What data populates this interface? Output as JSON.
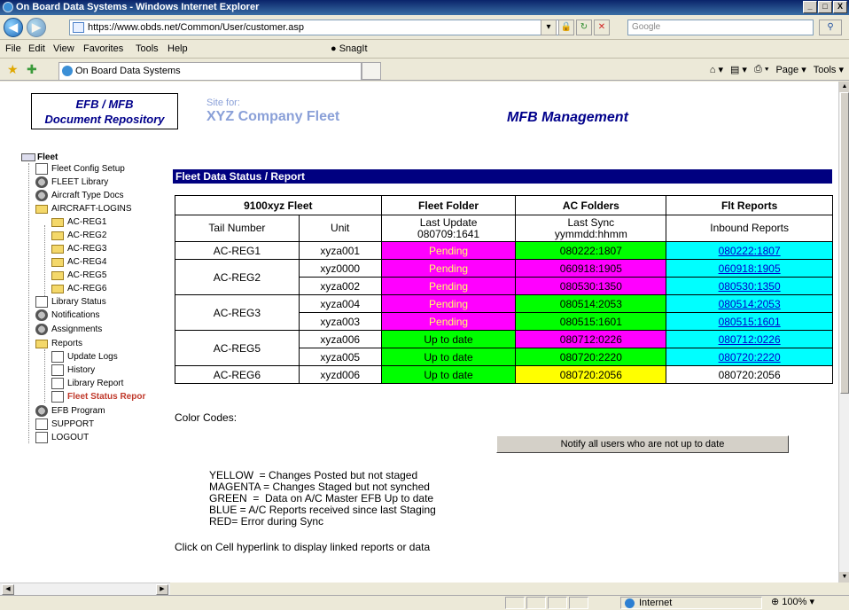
{
  "window": {
    "title": "On Board Data Systems - Windows Internet Explorer",
    "min": "_",
    "max": "□",
    "close": "X"
  },
  "address": {
    "url": "https://www.obds.net/Common/User/customer.asp",
    "search_placeholder": "Google"
  },
  "menu": {
    "items": [
      "File",
      "Edit",
      "View",
      "Favorites",
      "Tools",
      "Help"
    ],
    "snagit": "SnagIt"
  },
  "tab": {
    "title": "On Board Data Systems"
  },
  "commands": {
    "page": "Page",
    "tools": "Tools"
  },
  "header": {
    "logo_line1": "EFB / MFB",
    "logo_line2": "Document Repository",
    "site_for": "Site for:",
    "company": "XYZ Company  Fleet",
    "mfb": "MFB Management"
  },
  "tree": {
    "root": "Fleet",
    "items": [
      "Fleet Config Setup",
      "FLEET Library",
      "Aircraft Type Docs",
      "AIRCRAFT-LOGINS",
      "AC-REG1",
      "AC-REG2",
      "AC-REG3",
      "AC-REG4",
      "AC-REG5",
      "AC-REG6",
      "Library Status",
      "Notifications",
      "Assignments",
      "Reports",
      "Update Logs",
      "History",
      "Library Report",
      "Fleet Status Repor",
      "EFB Program",
      "SUPPORT",
      "LOGOUT"
    ]
  },
  "report": {
    "section_title": "Fleet Data Status / Report",
    "headers": {
      "fleet": "9100xyz Fleet",
      "folder": "Fleet Folder",
      "ac": "AC Folders",
      "flt": "Flt Reports"
    },
    "subheaders": {
      "tail": "Tail Number",
      "unit": "Unit",
      "folder_l1": "Last Update",
      "folder_l2": "080709:1641",
      "ac_l1": "Last Sync",
      "ac_l2": "yymmdd:hhmm",
      "flt": "Inbound Reports"
    },
    "rows": {
      "r1": {
        "tail": "AC-REG1",
        "unit": "xyza001",
        "folder": "Pending",
        "ac": "080222:1807",
        "flt": "080222:1807"
      },
      "r2": {
        "tail": "AC-REG2",
        "unit": "xyz0000",
        "folder": "Pending",
        "ac": "060918:1905",
        "flt": "060918:1905"
      },
      "r3": {
        "unit": "xyza002",
        "folder": "Pending",
        "ac": "080530:1350",
        "flt": "080530:1350"
      },
      "r4": {
        "tail": "AC-REG3",
        "unit": "xyza004",
        "folder": "Pending",
        "ac": "080514:2053",
        "flt": "080514:2053"
      },
      "r5": {
        "unit": "xyza003",
        "folder": "Pending",
        "ac": "080515:1601",
        "flt": "080515:1601"
      },
      "r6": {
        "tail": "AC-REG5",
        "unit": "xyza006",
        "folder": "Up to date",
        "ac": "080712:0226",
        "flt": "080712:0226"
      },
      "r7": {
        "unit": "xyza005",
        "folder": "Up to date",
        "ac": "080720:2220",
        "flt": "080720:2220"
      },
      "r8": {
        "tail": "AC-REG6",
        "unit": "xyzd006",
        "folder": "Up to date",
        "ac": "080720:2056",
        "flt": "080720:2056"
      }
    },
    "colors": {
      "magenta": "#ff00ff",
      "green": "#00ff00",
      "cyan": "#00ffff",
      "yellow": "#ffff00",
      "navy": "#000080"
    }
  },
  "footer": {
    "color_codes": "Color Codes:",
    "notify_button": "Notify all users who are not up to date",
    "legend": [
      "YELLOW  = Changes Posted but not staged",
      "MAGENTA = Changes Staged but not synched",
      "GREEN  =  Data on A/C Master EFB Up to date",
      "BLUE = A/C Reports received since last Staging",
      "RED= Error during Sync"
    ],
    "hint": "Click on Cell hyperlink to display linked reports or data"
  },
  "status": {
    "zone": "Internet",
    "zoom": "100%"
  },
  "icons": [
    "ie-icon",
    "back-icon",
    "forward-icon",
    "lock-icon",
    "refresh-icon",
    "stop-icon",
    "search-icon",
    "favorites-star-icon",
    "add-favorite-icon",
    "home-icon",
    "feeds-icon",
    "print-icon",
    "globe-icon"
  ]
}
